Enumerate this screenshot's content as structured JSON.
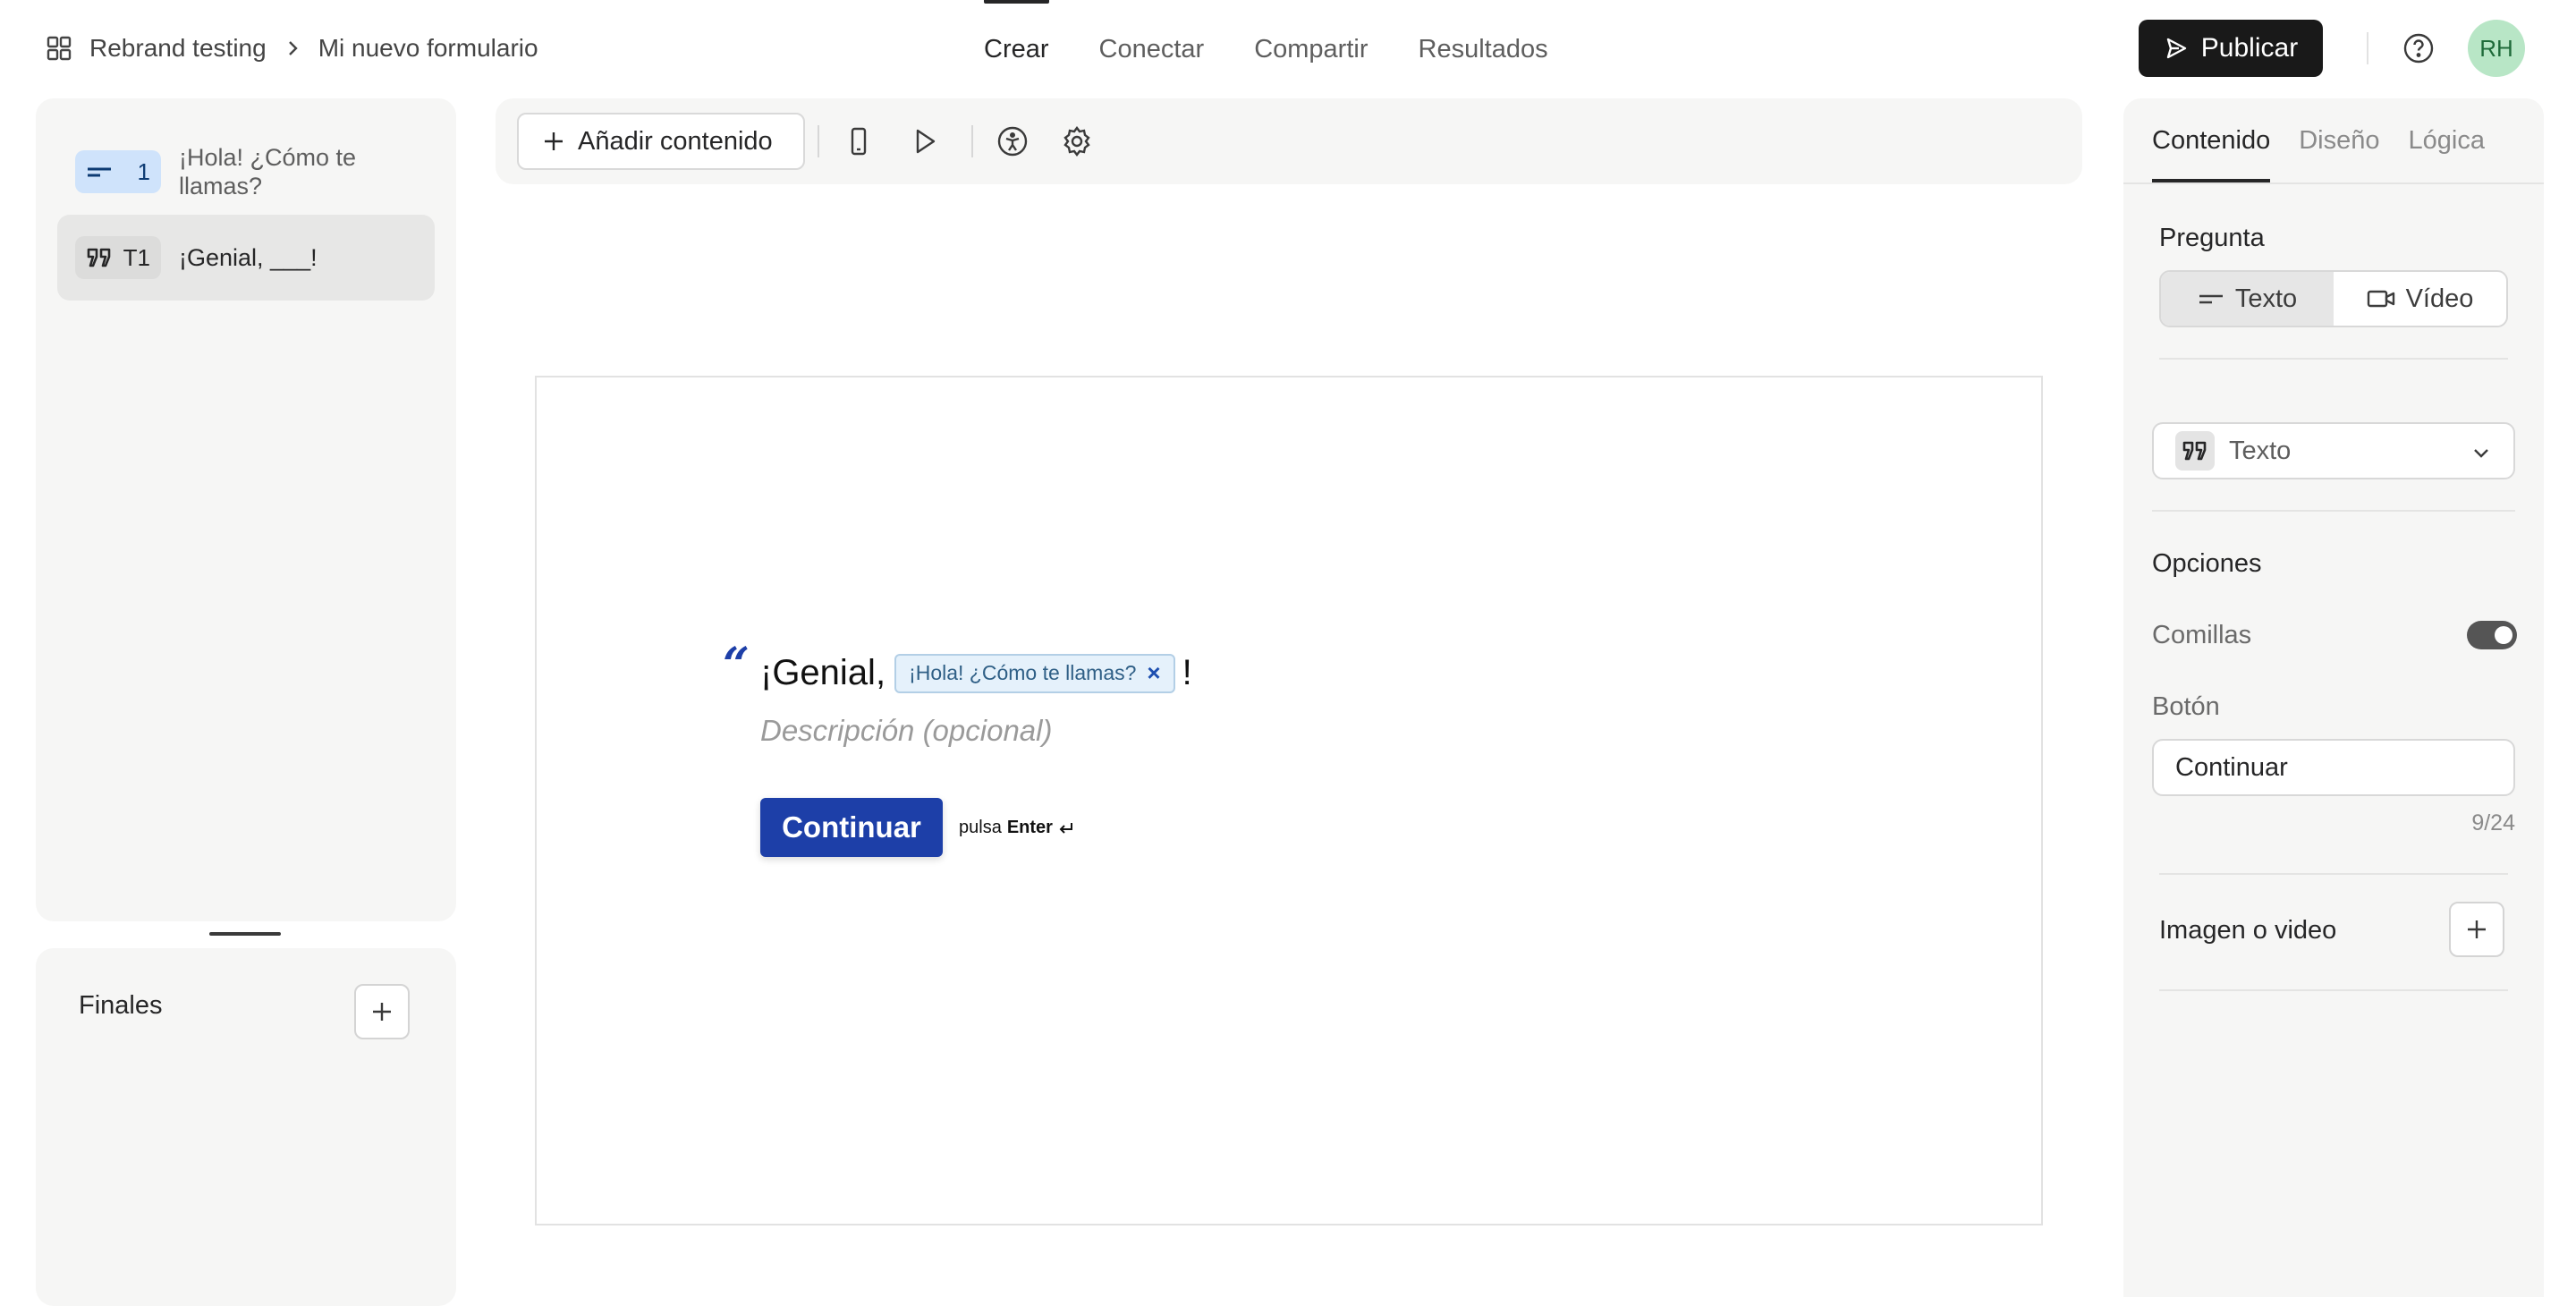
{
  "breadcrumb": {
    "workspace": "Rebrand testing",
    "form": "Mi nuevo formulario"
  },
  "nav": {
    "tabs": [
      "Crear",
      "Conectar",
      "Compartir",
      "Resultados"
    ],
    "active": "Crear"
  },
  "header": {
    "publish_label": "Publicar",
    "avatar_initials": "RH"
  },
  "sidebar": {
    "questions": [
      {
        "badge": "1",
        "label": "¡Hola! ¿Cómo te llamas?"
      },
      {
        "badge": "T1",
        "label": "¡Genial, ___!"
      }
    ],
    "endings_title": "Finales"
  },
  "toolbar": {
    "add_content_label": "Añadir contenido"
  },
  "preview": {
    "question_prefix": "¡Genial,",
    "recall_pill": "¡Hola! ¿Cómo te llamas?",
    "question_suffix": "!",
    "description_placeholder": "Descripción (opcional)",
    "button_label": "Continuar",
    "hint_prefix": "pulsa",
    "hint_key": "Enter"
  },
  "settings": {
    "tabs": [
      "Contenido",
      "Diseño",
      "Lógica"
    ],
    "active_tab": "Contenido",
    "question_title": "Pregunta",
    "question_modes": [
      "Texto",
      "Vídeo"
    ],
    "question_mode_selected": "Texto",
    "type_selected": "Texto",
    "options_title": "Opciones",
    "quotes_label": "Comillas",
    "quotes_enabled": true,
    "button_title": "Botón",
    "button_value": "Continuar",
    "button_counter": "9/24",
    "media_title": "Imagen o video"
  },
  "colors": {
    "accent": "#1d3fa8",
    "publish": "#191919",
    "avatar_bg": "#b8e6c6",
    "badge_blue": "#cfe3fb"
  }
}
